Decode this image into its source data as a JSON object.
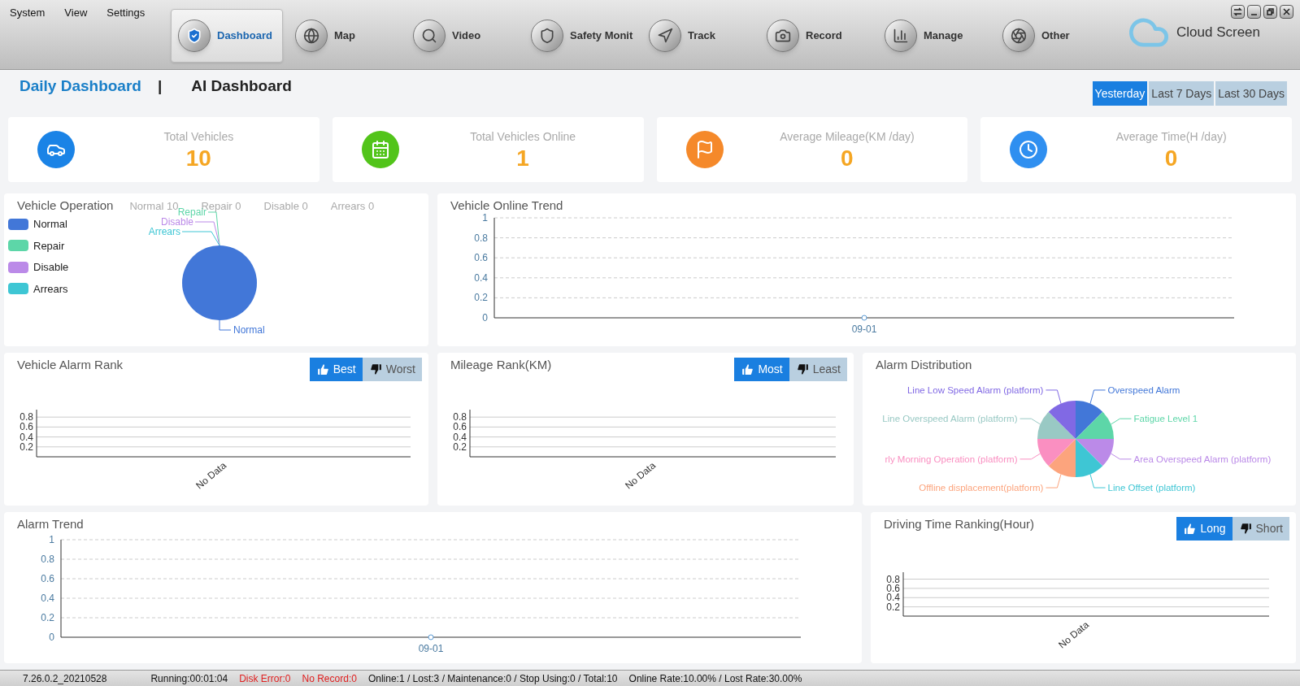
{
  "menu": [
    "System",
    "View",
    "Settings"
  ],
  "nav": [
    {
      "label": "Dashboard",
      "kind": "dashboard",
      "selected": true
    },
    {
      "label": "Map",
      "kind": "map",
      "selected": false
    },
    {
      "label": "Video",
      "kind": "video",
      "selected": false
    },
    {
      "label": "Safety Monit",
      "kind": "safety",
      "selected": false
    },
    {
      "label": "Track",
      "kind": "track",
      "selected": false
    },
    {
      "label": "Record",
      "kind": "record",
      "selected": false
    },
    {
      "label": "Manage",
      "kind": "manage",
      "selected": false
    },
    {
      "label": "Other",
      "kind": "other",
      "selected": false
    }
  ],
  "brand": "Cloud Screen",
  "dashboard_tabs": [
    {
      "label": "Daily Dashboard",
      "selected": true
    },
    {
      "label": "AI Dashboard",
      "selected": false
    }
  ],
  "tab_separator": "|",
  "periods": [
    {
      "label": "Yesterday",
      "selected": true
    },
    {
      "label": "Last 7 Days",
      "selected": false
    },
    {
      "label": "Last 30 Days",
      "selected": false
    }
  ],
  "stats": [
    {
      "label": "Total Vehicles",
      "value": "10",
      "kind": "car",
      "color": "#1a83e6"
    },
    {
      "label": "Total Vehicles Online",
      "value": "1",
      "kind": "calendar",
      "color": "#52c41a"
    },
    {
      "label": "Average Mileage(KM /day)",
      "value": "0",
      "kind": "flag",
      "color": "#f5892a"
    },
    {
      "label": "Average Time(H /day)",
      "value": "0",
      "kind": "clock",
      "color": "#2f8ff0"
    }
  ],
  "vehicle_operation": {
    "title": "Vehicle Operation",
    "counts": [
      "Normal 10",
      "Repair 0",
      "Disable 0",
      "Arrears 0"
    ],
    "chart_data": {
      "type": "pie",
      "categories": [
        "Normal",
        "Repair",
        "Disable",
        "Arrears"
      ],
      "series": [
        {
          "values": [
            100,
            0,
            0,
            0
          ]
        }
      ],
      "colors": [
        "#4277d8",
        "#5dd6a8",
        "#bb8ae8",
        "#3ec6d4"
      ]
    }
  },
  "online_trend": {
    "title": "Vehicle Online Trend",
    "chart_data": {
      "type": "line",
      "categories": [
        "09-01"
      ],
      "series": [
        {
          "color": "#5b9bd5",
          "marker": "circle",
          "values": [
            0
          ]
        }
      ],
      "grid": true,
      "ylim": [
        0,
        1
      ],
      "yticks": [
        0,
        0.2,
        0.4,
        0.6,
        0.8,
        1
      ]
    }
  },
  "alarm_rank": {
    "title": "Vehicle Alarm Rank",
    "toggle": [
      {
        "label": "Best",
        "kind": "up",
        "selected": true
      },
      {
        "label": "Worst",
        "kind": "down",
        "selected": false
      }
    ],
    "chart_data": {
      "type": "bar",
      "categories": [
        "No Data"
      ],
      "values": [
        null
      ],
      "grid": true,
      "ylim": [
        0,
        0.95
      ],
      "yticks": [
        0.2,
        0.4,
        0.6,
        0.8
      ]
    }
  },
  "mileage_rank": {
    "title": "Mileage Rank(KM)",
    "toggle": [
      {
        "label": "Most",
        "kind": "up",
        "selected": true
      },
      {
        "label": "Least",
        "kind": "down",
        "selected": false
      }
    ],
    "chart_data": {
      "type": "bar",
      "categories": [
        "No Data"
      ],
      "values": [
        null
      ],
      "grid": true,
      "ylim": [
        0,
        0.95
      ],
      "yticks": [
        0.2,
        0.4,
        0.6,
        0.8
      ]
    }
  },
  "alarm_distribution": {
    "title": "Alarm Distribution",
    "chart_data": {
      "type": "pie",
      "categories": [
        "Overspeed Alarm",
        "Fatigue Level 1",
        "Area Overspeed Alarm (platform)",
        "Line Offset (platform)",
        "Offline displacement(platform)",
        "rly Morning Operation (platform)",
        "Line Overspeed Alarm (platform)",
        "Line Low Speed Alarm (platform)"
      ],
      "series": [
        {
          "values": [
            12.5,
            12.5,
            12.5,
            12.5,
            12.5,
            12.5,
            12.5,
            12.5
          ]
        }
      ],
      "colors": [
        "#4277d8",
        "#5dd6a8",
        "#bb8ae8",
        "#3ec6d4",
        "#fca47d",
        "#fa8fc1",
        "#99c9c4",
        "#8169e4"
      ]
    }
  },
  "alarm_trend": {
    "title": "Alarm Trend",
    "chart_data": {
      "type": "line",
      "categories": [
        "09-01"
      ],
      "series": [
        {
          "color": "#5b9bd5",
          "marker": "circle",
          "values": [
            0
          ]
        }
      ],
      "grid": true,
      "ylim": [
        0,
        1
      ],
      "yticks": [
        0,
        0.2,
        0.4,
        0.6,
        0.8,
        1
      ]
    }
  },
  "driving_rank": {
    "title": "Driving Time Ranking(Hour)",
    "toggle": [
      {
        "label": "Long",
        "kind": "up",
        "selected": true
      },
      {
        "label": "Short",
        "kind": "down",
        "selected": false
      }
    ],
    "chart_data": {
      "type": "bar",
      "categories": [
        "No Data"
      ],
      "values": [
        null
      ],
      "grid": true,
      "ylim": [
        0,
        0.95
      ],
      "yticks": [
        0.2,
        0.4,
        0.6,
        0.8
      ]
    }
  },
  "status_bar": [
    {
      "text": "7.26.0.2_20210528",
      "alert": false
    },
    {
      "text": "Running:00:01:04",
      "alert": false
    },
    {
      "text": "Disk Error:0",
      "alert": true
    },
    {
      "text": "No Record:0",
      "alert": true
    },
    {
      "text": "Online:1 / Lost:3 / Maintenance:0 / Stop Using:0 / Total:10",
      "alert": false
    },
    {
      "text": "Online Rate:10.00% / Lost Rate:30.00%",
      "alert": false
    }
  ]
}
